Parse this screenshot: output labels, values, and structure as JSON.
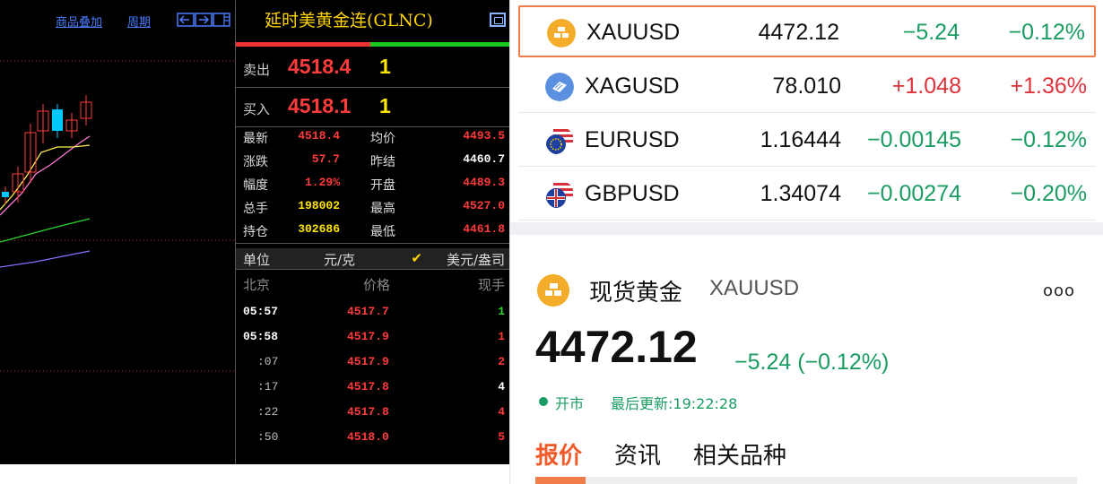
{
  "terminal": {
    "toolbar": {
      "overlay_label": "商品叠加",
      "period_label": "周期",
      "nav_icons": [
        "arrow-left-box-icon",
        "arrow-right-box-icon",
        "panel-toggle-icon"
      ]
    },
    "quote": {
      "title": "延时美黄金连(GLNC)",
      "sell": {
        "label": "卖出",
        "price": "4518.4",
        "volume": "1"
      },
      "buy": {
        "label": "买入",
        "price": "4518.1",
        "volume": "1"
      },
      "stats": [
        {
          "label": "最新",
          "value": "4518.4",
          "label2": "均价",
          "value2": "4493.5"
        },
        {
          "label": "涨跌",
          "value": "57.7",
          "label2": "昨结",
          "value2": "4460.7"
        },
        {
          "label": "幅度",
          "value": "1.29%",
          "label2": "开盘",
          "value2": "4489.3"
        },
        {
          "label": "总手",
          "value": "198002",
          "label2": "最高",
          "value2": "4527.0"
        },
        {
          "label": "持仓",
          "value": "302686",
          "label2": "最低",
          "value2": "4461.8"
        }
      ],
      "unit": {
        "label": "单位",
        "yuan": "元/克",
        "check": "✔",
        "usd": "美元/盎司"
      },
      "tick_header": {
        "time": "北京",
        "price": "价格",
        "volume": "现手"
      },
      "ticks": [
        {
          "time": "05:57",
          "price": "4517.7",
          "volume": "1",
          "vol_color": "green"
        },
        {
          "time": "05:58",
          "price": "4517.9",
          "volume": "1",
          "vol_color": "red"
        },
        {
          "time": ":07",
          "price": "4517.9",
          "volume": "2",
          "vol_color": "red"
        },
        {
          "time": ":17",
          "price": "4517.8",
          "volume": "4",
          "vol_color": "white"
        },
        {
          "time": ":22",
          "price": "4517.8",
          "volume": "4",
          "vol_color": "red"
        },
        {
          "time": ":50",
          "price": "4518.0",
          "volume": "5",
          "vol_color": "red"
        }
      ]
    }
  },
  "app": {
    "watchlist": [
      {
        "symbol": "XAUUSD",
        "price": "4472.12",
        "change": "−5.24",
        "percent": "−0.12%",
        "direction": "down",
        "icon": "gold-bar-icon",
        "selected": true
      },
      {
        "symbol": "XAGUSD",
        "price": "78.010",
        "change": "+1.048",
        "percent": "+1.36%",
        "direction": "up",
        "icon": "silver-bar-icon",
        "selected": false
      },
      {
        "symbol": "EURUSD",
        "price": "1.16444",
        "change": "−0.00145",
        "percent": "−0.12%",
        "direction": "down",
        "icon": "eu-us-flag-icon",
        "selected": false
      },
      {
        "symbol": "GBPUSD",
        "price": "1.34074",
        "change": "−0.00274",
        "percent": "−0.20%",
        "direction": "down",
        "icon": "uk-us-flag-icon",
        "selected": false
      }
    ],
    "detail": {
      "name": "现货黄金",
      "symbol": "XAUUSD",
      "more": "ooo",
      "price": "4472.12",
      "change": "−5.24 (−0.12%)",
      "status": "开市",
      "updated": "最后更新:19:22:28",
      "tabs": [
        "报价",
        "资讯",
        "相关品种"
      ],
      "active_tab": 0
    },
    "colors": {
      "up": "#e0323c",
      "down": "#1a9c62",
      "accent": "#f07c4a",
      "gold": "#f3ad2a",
      "silver": "#5b8fe0"
    }
  }
}
